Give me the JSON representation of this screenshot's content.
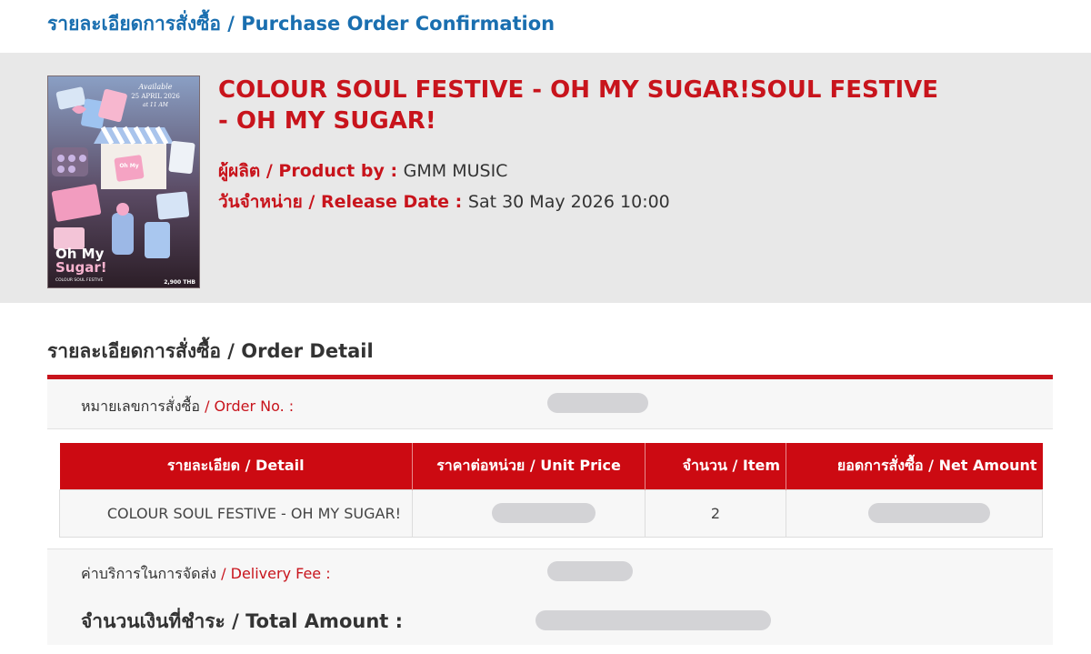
{
  "page": {
    "title": "รายละเอียดการสั่งซื้อ / Purchase Order Confirmation"
  },
  "product": {
    "title": "COLOUR SOUL FESTIVE - OH MY SUGAR!SOUL FESTIVE - OH MY SUGAR!",
    "maker_label": "ผู้ผลิต / Product by : ",
    "maker_value": "GMM MUSIC",
    "release_label": "วันจำหน่าย / Release Date : ",
    "release_value": "Sat 30 May 2026 10:00",
    "poster": {
      "available": "Available",
      "date": "25 APRIL 2026",
      "time": "at 11 AM",
      "brand_line1": "Oh My",
      "brand_line2": "Sugar!",
      "brand_sub": "COLOUR SOUL FESTIVE",
      "price": "2,900 THB"
    }
  },
  "order_detail": {
    "section_title": "รายละเอียดการสั่งซื้อ / Order Detail",
    "order_no_label_th": "หมายเลขการสั่งซื้อ",
    "order_no_label_en": " / Order No. :",
    "table": {
      "headers": [
        "รายละเอียด / Detail",
        "ราคาต่อหน่วย / Unit Price",
        "จำนวน / Item",
        "ยอดการสั่งซื้อ / Net Amount"
      ],
      "rows": [
        {
          "detail": "COLOUR SOUL FESTIVE - OH MY SUGAR!",
          "item": "2"
        }
      ]
    },
    "delivery_label_th": "ค่าบริการในการจัดส่ง",
    "delivery_label_en": " / Delivery Fee :",
    "total_label": "จำนวนเงินที่ชำระ / Total Amount :"
  },
  "colors": {
    "accent_red": "#c8141c",
    "header_red": "#cc0a12",
    "title_blue": "#1a6fb0",
    "band_gray": "#e8e8e8",
    "redaction_gray": "#d3d3d6"
  }
}
